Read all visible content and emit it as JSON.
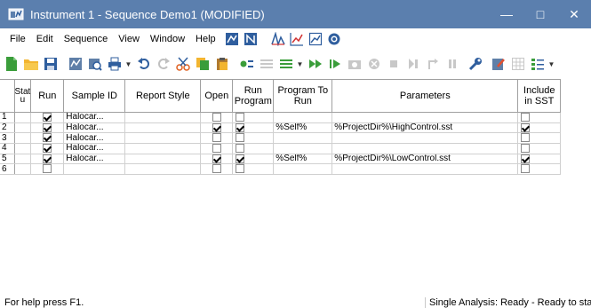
{
  "titlebar": {
    "title": "Instrument 1 - Sequence Demo1 (MODIFIED)",
    "minimize": "—",
    "maximize": "□",
    "close": "✕"
  },
  "menubar": {
    "items": [
      "File",
      "Edit",
      "Sequence",
      "View",
      "Window",
      "Help"
    ]
  },
  "table": {
    "headers": {
      "status": "Stat\nu",
      "run": "Run",
      "sample_id": "Sample ID",
      "report_style": "Report Style",
      "open": "Open",
      "run_program": "Run Program",
      "program_to_run": "Program To Run",
      "parameters": "Parameters",
      "include_sst": "Include in SST"
    },
    "rows": [
      {
        "num": "1",
        "run": true,
        "sample_id": "Halocar...",
        "report_style": "",
        "open": false,
        "run_program": false,
        "program_to_run": "",
        "parameters": "",
        "include_sst": false
      },
      {
        "num": "2",
        "run": true,
        "sample_id": "Halocar...",
        "report_style": "",
        "open": true,
        "run_program": true,
        "program_to_run": "%Self%",
        "parameters": "%ProjectDir%\\HighControl.sst",
        "include_sst": true
      },
      {
        "num": "3",
        "run": true,
        "sample_id": "Halocar...",
        "report_style": "",
        "open": false,
        "run_program": false,
        "program_to_run": "",
        "parameters": "",
        "include_sst": false
      },
      {
        "num": "4",
        "run": true,
        "sample_id": "Halocar...",
        "report_style": "",
        "open": false,
        "run_program": false,
        "program_to_run": "",
        "parameters": "",
        "include_sst": false
      },
      {
        "num": "5",
        "run": true,
        "sample_id": "Halocar...",
        "report_style": "",
        "open": true,
        "run_program": true,
        "program_to_run": "%Self%",
        "parameters": "%ProjectDir%\\LowControl.sst",
        "include_sst": true
      },
      {
        "num": "6",
        "run": false,
        "sample_id": "",
        "report_style": "",
        "open": false,
        "run_program": false,
        "program_to_run": "",
        "parameters": "",
        "include_sst": false
      }
    ]
  },
  "statusbar": {
    "left": "For help press F1.",
    "right": "Single Analysis: Ready - Ready to start"
  },
  "colors": {
    "titlebar": "#5b7fae",
    "accent_green": "#3a9d3a",
    "accent_yellow": "#f2b530",
    "accent_blue": "#2f5e9e"
  }
}
